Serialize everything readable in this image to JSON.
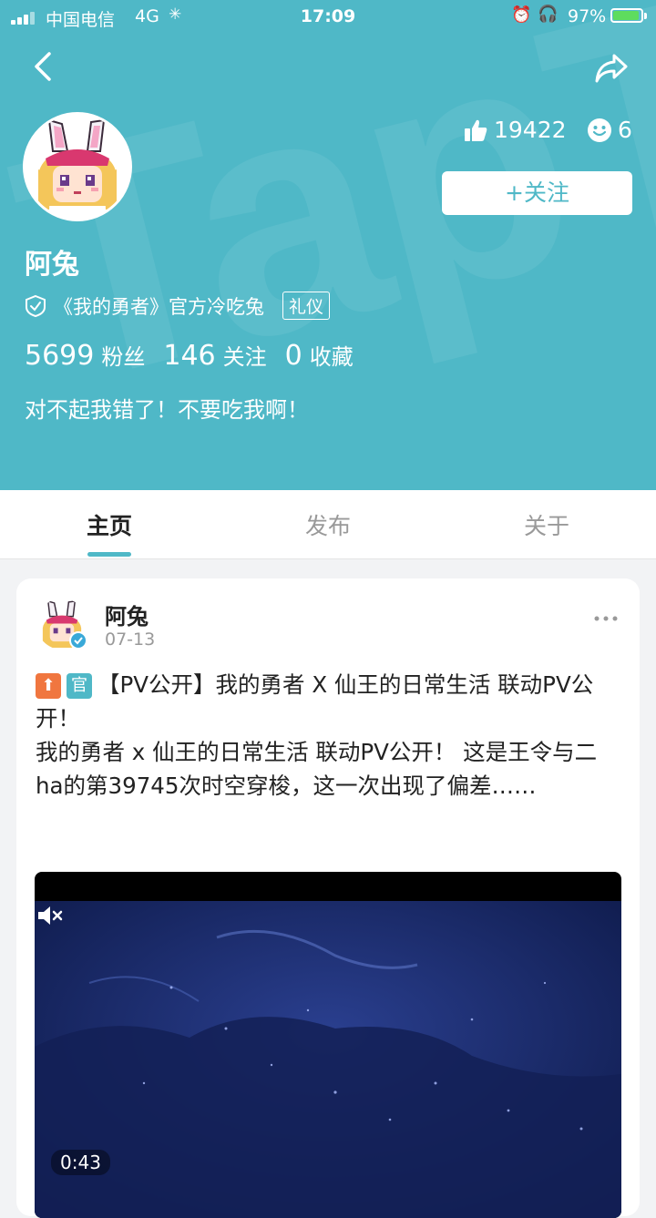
{
  "status_bar": {
    "carrier": "中国电信",
    "network": "4G",
    "time": "17:09",
    "battery": "97%"
  },
  "profile": {
    "likes": "19422",
    "mood_count": "6",
    "follow_label": "+关注",
    "name": "阿兔",
    "verify_text": "《我的勇者》官方冷吃兔",
    "tag": "礼仪",
    "fans_count": "5699",
    "fans_label": "粉丝",
    "following_count": "146",
    "following_label": "关注",
    "fav_count": "0",
    "fav_label": "收藏",
    "bio": "对不起我错了！不要吃我啊！"
  },
  "tabs": [
    {
      "label": "主页",
      "active": true
    },
    {
      "label": "发布",
      "active": false
    },
    {
      "label": "关于",
      "active": false
    }
  ],
  "post": {
    "author": "阿兔",
    "date": "07-13",
    "pill_up": "⬆",
    "pill_official": "官",
    "title": "【PV公开】我的勇者 X 仙王的日常生活 联动PV公开！",
    "body": "我的勇者 x 仙王的日常生活 联动PV公开！ 这是王令与二ha的第39745次时空穿梭，这一次出现了偏差……",
    "video_duration": "0:43"
  },
  "colors": {
    "brand": "#4fb8c7",
    "upvote_pill": "#f0763f"
  }
}
